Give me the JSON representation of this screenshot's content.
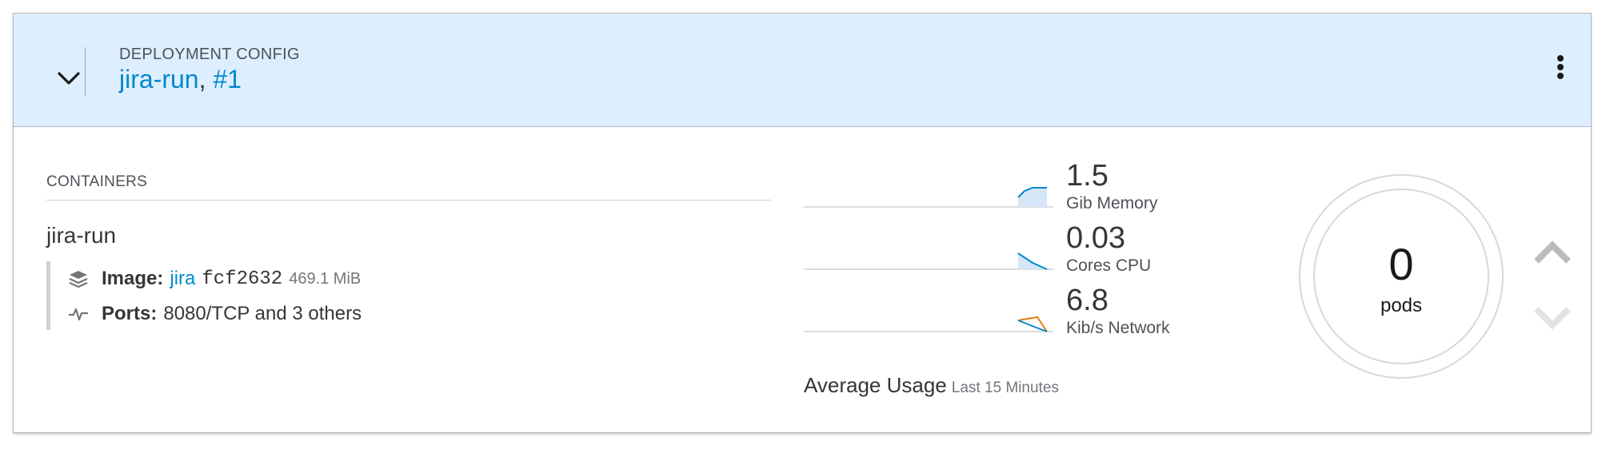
{
  "header": {
    "kind_label": "DEPLOYMENT CONFIG",
    "name_link": "jira-run",
    "separator": ",",
    "version_link": "#1",
    "toggle_icon": "chevron-down-icon",
    "actions_icon": "kebab-icon"
  },
  "containers": {
    "heading": "CONTAINERS",
    "name": "jira-run",
    "image": {
      "label": "Image:",
      "link": "jira",
      "hash": "fcf2632",
      "size": "469.1 MiB",
      "icon": "layers-icon"
    },
    "ports": {
      "label": "Ports:",
      "value": "8080/TCP and 3 others",
      "icon": "pulse-icon"
    }
  },
  "metrics": {
    "memory": {
      "value": "1.5",
      "unit": "Gib Memory"
    },
    "cpu": {
      "value": "0.03",
      "unit": "Cores CPU"
    },
    "network": {
      "value": "6.8",
      "unit": "Kib/s Network"
    },
    "average_label": "Average Usage",
    "average_sub": "Last 15 Minutes"
  },
  "pods": {
    "count": "0",
    "label": "pods",
    "scale_up_icon": "chevron-up-icon",
    "scale_down_icon": "chevron-down-icon"
  },
  "colors": {
    "header_bg": "#ddefff",
    "link": "#0088ce",
    "spark_blue": "#0088ce",
    "spark_orange": "#ec7a08"
  }
}
